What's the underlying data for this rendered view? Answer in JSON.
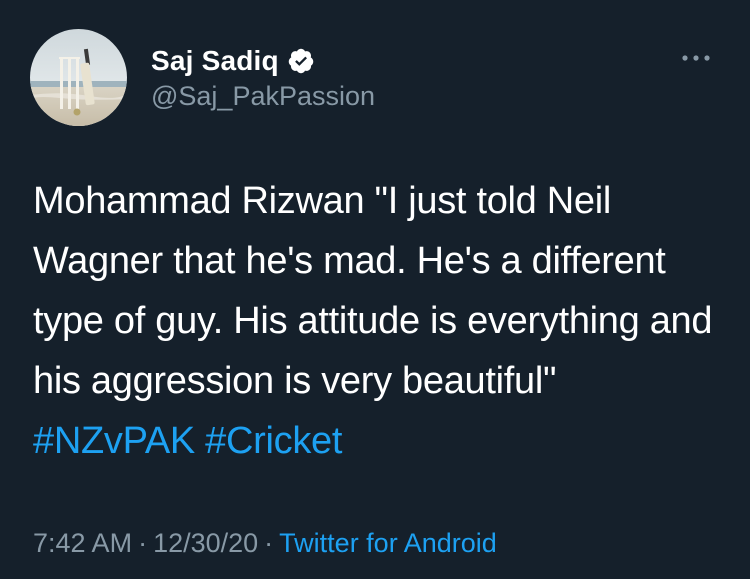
{
  "user": {
    "display_name": "Saj Sadiq",
    "handle": "@Saj_PakPassion",
    "avatar": "cricket-stumps-on-beach",
    "verified_icon": "verified-badge-icon"
  },
  "menu": {
    "more_icon": "ellipsis-icon"
  },
  "tweet": {
    "text": "Mohammad Rizwan \"I just told Neil Wagner that he's mad. He's a different type of guy. His attitude is everything and his aggression is very beautiful\"",
    "hashtags": [
      "#NZvPAK",
      "#Cricket"
    ]
  },
  "meta": {
    "time": "7:42 AM",
    "separator": "·",
    "date": "12/30/20",
    "source": "Twitter for Android"
  },
  "colors": {
    "background": "#15202b",
    "text": "#ffffff",
    "secondary": "#8899a6",
    "accent": "#1da1f2"
  }
}
